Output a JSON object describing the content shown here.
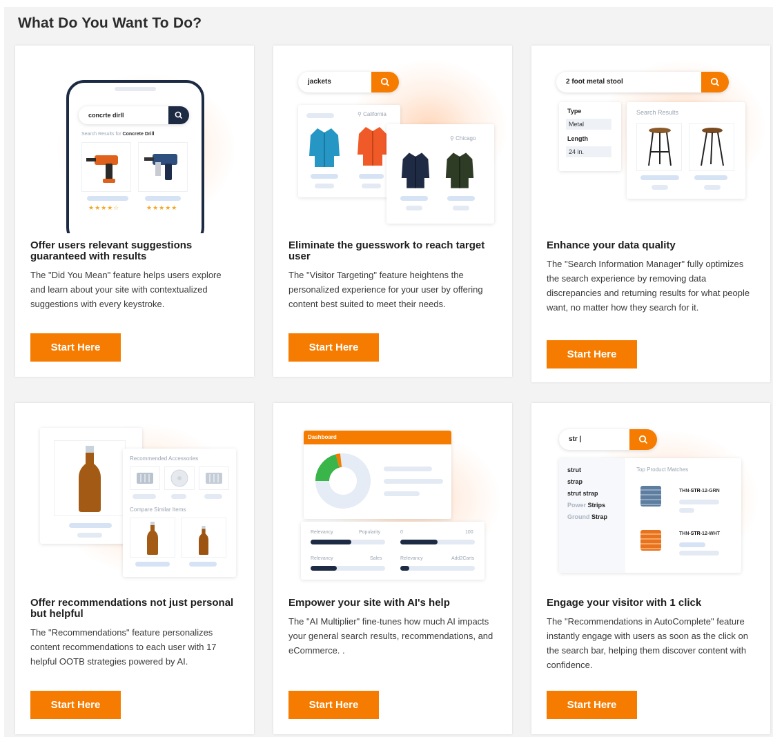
{
  "page_title": "What Do You Want To Do?",
  "colors": {
    "accent": "#f57c00",
    "background": "#f3f3f3",
    "card": "#ffffff"
  },
  "cards": [
    {
      "title": "Offer users relevant suggestions guaranteed with results",
      "description": "The \"Did You Mean\" feature helps users explore and learn about your site with contextualized suggestions with every keystroke.",
      "button_label": "Start Here",
      "illustration": {
        "query": "concrte dirll",
        "results_prefix": "Search Results for",
        "results_term": "Concrete Drill",
        "icons": [
          "phone-icon",
          "hammer-drill-icon",
          "rotary-drill-icon"
        ]
      }
    },
    {
      "title": "Eliminate the guesswork to reach target user",
      "description": "The \"Visitor Targeting\" feature heightens the personalized experience for your user by offering content best suited to meet their needs.",
      "button_label": "Start Here",
      "illustration": {
        "query": "jackets",
        "location_1": "California",
        "location_2": "Chicago",
        "icons": [
          "jacket-icon"
        ]
      }
    },
    {
      "title": "Enhance your data quality",
      "description": "The \"Search Information Manager\" fully optimizes the search experience by removing data discrepancies and returning results for what people want, no matter how they search for it.",
      "button_label": "Start Here",
      "illustration": {
        "query": "2 foot metal stool",
        "filter_1_label": "Type",
        "filter_1_value": "Metal",
        "filter_2_label": "Length",
        "filter_2_value": "24 in.",
        "results_heading": "Search Results",
        "icons": [
          "stool-icon"
        ]
      }
    },
    {
      "title": "Offer recommendations not just personal but helpful",
      "description": "The \"Recommendations\" feature personalizes content recommendations to each user with 17 helpful OOTB strategies powered by AI.",
      "button_label": "Start Here",
      "illustration": {
        "heading_1": "Recommended Accessories",
        "heading_2": "Compare Similar Items",
        "icons": [
          "bottle-icon",
          "cap-icon"
        ]
      }
    },
    {
      "title": "Empower your site with AI's help",
      "description": "The \"AI Multiplier\" fine-tunes how much AI impacts your general search results, recommendations, and eCommerce. .",
      "button_label": "Start Here",
      "illustration": {
        "dashboard_label": "Dashboard",
        "slider_1_left": "Relevancy",
        "slider_1_right": "Popularity",
        "slider_2_left": "0",
        "slider_2_right": "100",
        "slider_3_left": "Relevancy",
        "slider_3_right": "Sales",
        "slider_4_left": "Relevancy",
        "slider_4_right": "Add2Carts",
        "slider_levels": [
          0.55,
          0.5,
          0.35,
          0.12
        ],
        "icons": [
          "donut-chart-icon"
        ]
      }
    },
    {
      "title": "Engage your visitor with 1 click",
      "description": "The \"Recommendations in AutoComplete\" feature instantly engage with users as soon as the click on the search bar, helping them discover content with confidence.",
      "button_label": "Start Here",
      "illustration": {
        "query": "str |",
        "suggestions": [
          "strut",
          "strap",
          "strut strap"
        ],
        "suggestion_4_prefix": "Power",
        "suggestion_4_bold": "Strips",
        "suggestion_5_prefix": "Ground",
        "suggestion_5_bold": "Strap",
        "matches_heading": "Top Product Matches",
        "sku_1_prefix": "THN-",
        "sku_1_bold": "STR",
        "sku_1_suffix": "-12-GRN",
        "sku_2_prefix": "THN-",
        "sku_2_bold": "STR",
        "sku_2_suffix": "-12-WHT",
        "icons": [
          "wire-spool-icon"
        ]
      }
    }
  ]
}
